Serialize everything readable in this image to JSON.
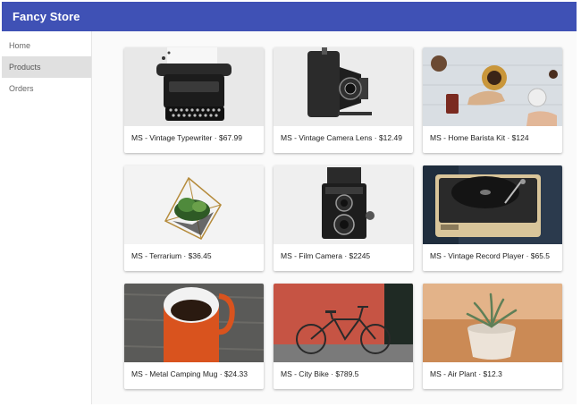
{
  "app": {
    "title": "Fancy Store",
    "accent_color": "#3f51b5"
  },
  "sidebar": {
    "items": [
      {
        "label": "Home",
        "active": false
      },
      {
        "label": "Products",
        "active": true
      },
      {
        "label": "Orders",
        "active": false
      }
    ]
  },
  "products": [
    {
      "name": "MS - Vintage Typewriter",
      "price": "$67.99",
      "image": "typewriter"
    },
    {
      "name": "MS - Vintage Camera Lens",
      "price": "$12.49",
      "image": "folding-camera"
    },
    {
      "name": "MS - Home Barista Kit",
      "price": "$124",
      "image": "barista-kit"
    },
    {
      "name": "MS - Terrarium",
      "price": "$36.45",
      "image": "terrarium"
    },
    {
      "name": "MS - Film Camera",
      "price": "$2245",
      "image": "film-camera"
    },
    {
      "name": "MS - Vintage Record Player",
      "price": "$65.5",
      "image": "record-player"
    },
    {
      "name": "MS - Metal Camping Mug",
      "price": "$24.33",
      "image": "camping-mug"
    },
    {
      "name": "MS - City Bike",
      "price": "$789.5",
      "image": "city-bike"
    },
    {
      "name": "MS - Air Plant",
      "price": "$12.3",
      "image": "air-plant"
    }
  ]
}
